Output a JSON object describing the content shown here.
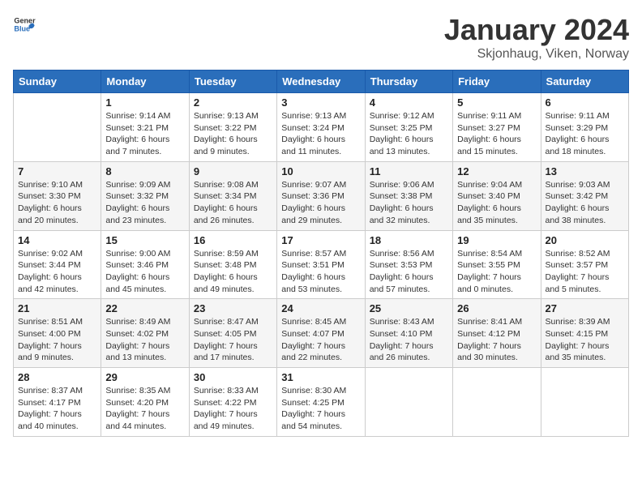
{
  "header": {
    "logo_general": "General",
    "logo_blue": "Blue",
    "title": "January 2024",
    "subtitle": "Skjonhaug, Viken, Norway"
  },
  "days_of_week": [
    "Sunday",
    "Monday",
    "Tuesday",
    "Wednesday",
    "Thursday",
    "Friday",
    "Saturday"
  ],
  "weeks": [
    [
      {
        "day": "",
        "info": ""
      },
      {
        "day": "1",
        "info": "Sunrise: 9:14 AM\nSunset: 3:21 PM\nDaylight: 6 hours\nand 7 minutes."
      },
      {
        "day": "2",
        "info": "Sunrise: 9:13 AM\nSunset: 3:22 PM\nDaylight: 6 hours\nand 9 minutes."
      },
      {
        "day": "3",
        "info": "Sunrise: 9:13 AM\nSunset: 3:24 PM\nDaylight: 6 hours\nand 11 minutes."
      },
      {
        "day": "4",
        "info": "Sunrise: 9:12 AM\nSunset: 3:25 PM\nDaylight: 6 hours\nand 13 minutes."
      },
      {
        "day": "5",
        "info": "Sunrise: 9:11 AM\nSunset: 3:27 PM\nDaylight: 6 hours\nand 15 minutes."
      },
      {
        "day": "6",
        "info": "Sunrise: 9:11 AM\nSunset: 3:29 PM\nDaylight: 6 hours\nand 18 minutes."
      }
    ],
    [
      {
        "day": "7",
        "info": "Sunrise: 9:10 AM\nSunset: 3:30 PM\nDaylight: 6 hours\nand 20 minutes."
      },
      {
        "day": "8",
        "info": "Sunrise: 9:09 AM\nSunset: 3:32 PM\nDaylight: 6 hours\nand 23 minutes."
      },
      {
        "day": "9",
        "info": "Sunrise: 9:08 AM\nSunset: 3:34 PM\nDaylight: 6 hours\nand 26 minutes."
      },
      {
        "day": "10",
        "info": "Sunrise: 9:07 AM\nSunset: 3:36 PM\nDaylight: 6 hours\nand 29 minutes."
      },
      {
        "day": "11",
        "info": "Sunrise: 9:06 AM\nSunset: 3:38 PM\nDaylight: 6 hours\nand 32 minutes."
      },
      {
        "day": "12",
        "info": "Sunrise: 9:04 AM\nSunset: 3:40 PM\nDaylight: 6 hours\nand 35 minutes."
      },
      {
        "day": "13",
        "info": "Sunrise: 9:03 AM\nSunset: 3:42 PM\nDaylight: 6 hours\nand 38 minutes."
      }
    ],
    [
      {
        "day": "14",
        "info": "Sunrise: 9:02 AM\nSunset: 3:44 PM\nDaylight: 6 hours\nand 42 minutes."
      },
      {
        "day": "15",
        "info": "Sunrise: 9:00 AM\nSunset: 3:46 PM\nDaylight: 6 hours\nand 45 minutes."
      },
      {
        "day": "16",
        "info": "Sunrise: 8:59 AM\nSunset: 3:48 PM\nDaylight: 6 hours\nand 49 minutes."
      },
      {
        "day": "17",
        "info": "Sunrise: 8:57 AM\nSunset: 3:51 PM\nDaylight: 6 hours\nand 53 minutes."
      },
      {
        "day": "18",
        "info": "Sunrise: 8:56 AM\nSunset: 3:53 PM\nDaylight: 6 hours\nand 57 minutes."
      },
      {
        "day": "19",
        "info": "Sunrise: 8:54 AM\nSunset: 3:55 PM\nDaylight: 7 hours\nand 0 minutes."
      },
      {
        "day": "20",
        "info": "Sunrise: 8:52 AM\nSunset: 3:57 PM\nDaylight: 7 hours\nand 5 minutes."
      }
    ],
    [
      {
        "day": "21",
        "info": "Sunrise: 8:51 AM\nSunset: 4:00 PM\nDaylight: 7 hours\nand 9 minutes."
      },
      {
        "day": "22",
        "info": "Sunrise: 8:49 AM\nSunset: 4:02 PM\nDaylight: 7 hours\nand 13 minutes."
      },
      {
        "day": "23",
        "info": "Sunrise: 8:47 AM\nSunset: 4:05 PM\nDaylight: 7 hours\nand 17 minutes."
      },
      {
        "day": "24",
        "info": "Sunrise: 8:45 AM\nSunset: 4:07 PM\nDaylight: 7 hours\nand 22 minutes."
      },
      {
        "day": "25",
        "info": "Sunrise: 8:43 AM\nSunset: 4:10 PM\nDaylight: 7 hours\nand 26 minutes."
      },
      {
        "day": "26",
        "info": "Sunrise: 8:41 AM\nSunset: 4:12 PM\nDaylight: 7 hours\nand 30 minutes."
      },
      {
        "day": "27",
        "info": "Sunrise: 8:39 AM\nSunset: 4:15 PM\nDaylight: 7 hours\nand 35 minutes."
      }
    ],
    [
      {
        "day": "28",
        "info": "Sunrise: 8:37 AM\nSunset: 4:17 PM\nDaylight: 7 hours\nand 40 minutes."
      },
      {
        "day": "29",
        "info": "Sunrise: 8:35 AM\nSunset: 4:20 PM\nDaylight: 7 hours\nand 44 minutes."
      },
      {
        "day": "30",
        "info": "Sunrise: 8:33 AM\nSunset: 4:22 PM\nDaylight: 7 hours\nand 49 minutes."
      },
      {
        "day": "31",
        "info": "Sunrise: 8:30 AM\nSunset: 4:25 PM\nDaylight: 7 hours\nand 54 minutes."
      },
      {
        "day": "",
        "info": ""
      },
      {
        "day": "",
        "info": ""
      },
      {
        "day": "",
        "info": ""
      }
    ]
  ]
}
